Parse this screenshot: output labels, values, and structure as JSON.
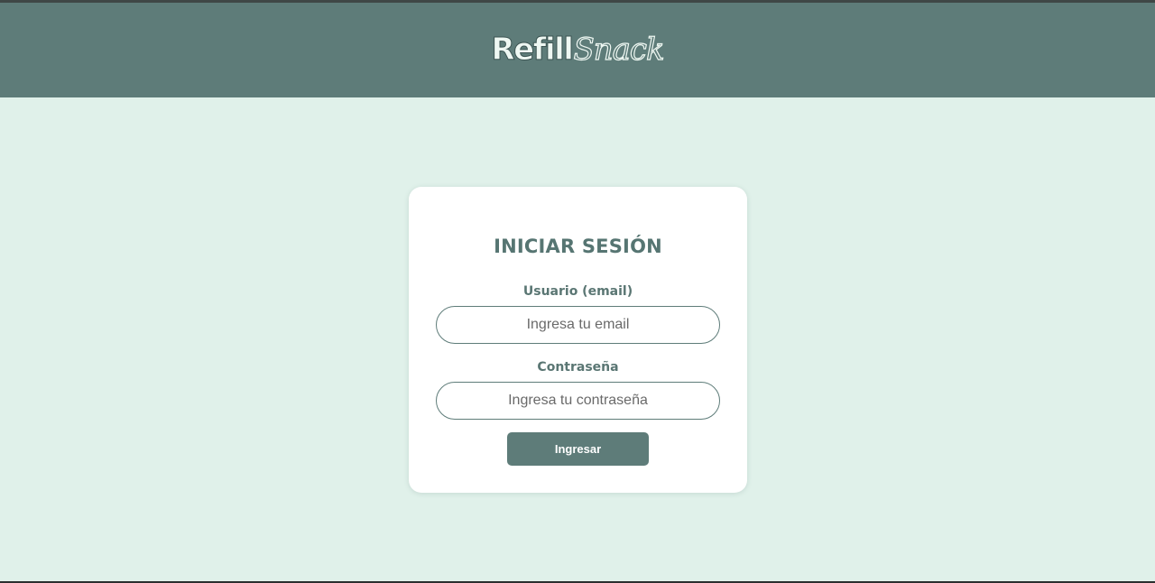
{
  "header": {
    "logo_part1": "Refill",
    "logo_part2": "Snack"
  },
  "login": {
    "title": "INICIAR SESIÓN",
    "email_label": "Usuario (email)",
    "email_placeholder": "Ingresa tu email",
    "email_value": "",
    "password_label": "Contraseña",
    "password_placeholder": "Ingresa tu contraseña",
    "password_value": "",
    "submit_label": "Ingresar"
  },
  "colors": {
    "header_bg": "#5e7c79",
    "page_bg": "#e0f1ea",
    "card_bg": "#ffffff",
    "accent": "#5e7c79",
    "title_text": "#567572"
  }
}
